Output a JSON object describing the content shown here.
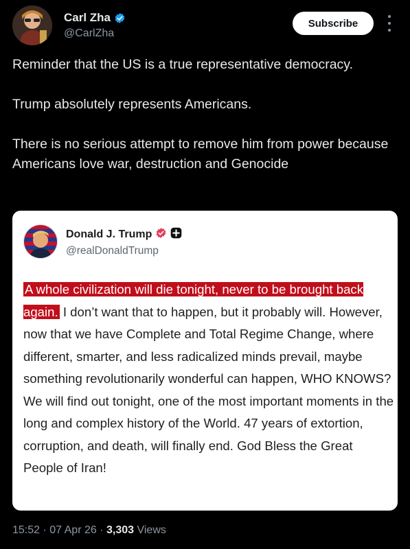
{
  "author": {
    "display_name": "Carl Zha",
    "handle": "@CarlZha"
  },
  "actions": {
    "subscribe_label": "Subscribe"
  },
  "tweet": {
    "paragraphs": [
      "Reminder that the US is a true representative democracy.",
      "Trump absolutely represents Americans.",
      "There is no serious attempt to remove him from power because Americans love war, destruction and Genocide"
    ]
  },
  "quoted_post": {
    "display_name": "Donald J. Trump",
    "handle": "@realDonaldTrump",
    "highlighted_text": "A whole civilization will die tonight, never to be brought back again.",
    "body_text": " I don’t want that to happen, but it probably will. However, now that we have Complete and Total Regime Change, where different, smarter, and less radicalized minds prevail, maybe something revolutionarily wonderful can happen, WHO KNOWS? We will find out tonight, one of the most important moments in the long and complex history of the World. 47 years of extortion, corruption, and death, will finally end. God Bless the Great People of Iran!"
  },
  "meta": {
    "time": "15:52",
    "separator": " · ",
    "date": "07 Apr 26",
    "views_count": "3,303",
    "views_label": " Views"
  },
  "colors": {
    "background": "#000000",
    "verified_blue": "#1d9bf0",
    "truth_verified": "#e0405a",
    "highlight_red": "#c10e1b"
  },
  "icons": {
    "verified": "verified-badge-icon",
    "more": "more-vertical-icon",
    "truth_verified": "truth-verified-icon",
    "truth_plus": "plus-badge-icon"
  }
}
